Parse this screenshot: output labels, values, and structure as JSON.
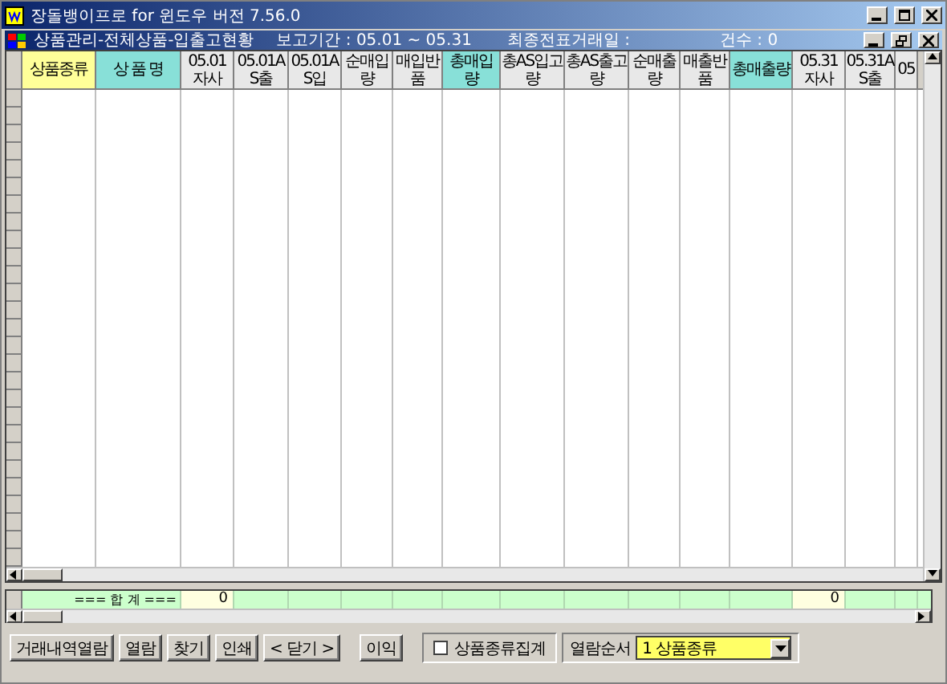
{
  "window": {
    "title": "장돌뱅이프로 for 윈도우 버전 7.56.0"
  },
  "child_window": {
    "title": "상품관리-전체상품-입출고현황",
    "period": "보고기간 : 05.01 ~ 05.31",
    "last_date": "최종전표거래일 :",
    "count": "건수 : 0"
  },
  "table": {
    "columns": [
      {
        "label": "상품종류",
        "kind": "key"
      },
      {
        "label": "상 품 명",
        "kind": "accent"
      },
      {
        "label": "05.01자사",
        "kind": "normal",
        "total": "0"
      },
      {
        "label": "05.01AS출",
        "kind": "normal"
      },
      {
        "label": "05.01AS입",
        "kind": "normal"
      },
      {
        "label": "순매입량",
        "kind": "normal"
      },
      {
        "label": "매입반품",
        "kind": "normal"
      },
      {
        "label": "총매입량",
        "kind": "accent"
      },
      {
        "label": "총AS입고량",
        "kind": "normal"
      },
      {
        "label": "총AS출고량",
        "kind": "normal"
      },
      {
        "label": "순매출량",
        "kind": "normal"
      },
      {
        "label": "매출반품",
        "kind": "normal"
      },
      {
        "label": "총매출량",
        "kind": "accent"
      },
      {
        "label": "05.31자사",
        "kind": "normal",
        "total": "0"
      },
      {
        "label": "05.31AS출",
        "kind": "normal"
      },
      {
        "label": "05",
        "kind": "normal"
      }
    ],
    "total_label": "=== 합 계 ==="
  },
  "buttons": [
    "거래내역열람",
    "열람",
    "찾기",
    "인쇄",
    "< 닫기 >"
  ],
  "profit_button": "이익",
  "group_checkbox": {
    "label": "상품종류집계",
    "checked": false
  },
  "sort": {
    "label": "열람순서",
    "value": "1 상품종류"
  }
}
